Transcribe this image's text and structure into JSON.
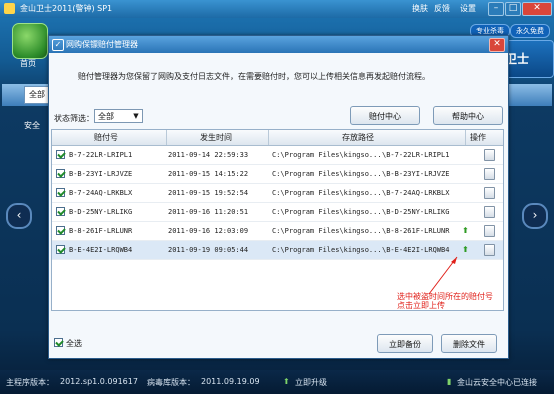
{
  "app": {
    "title": "金山卫士2011(警钟) SP1",
    "titlebar_links": {
      "skin": "换肤",
      "feedback": "反馈",
      "settings": "设置"
    },
    "badges": [
      "专业杀毒",
      "永久免费"
    ],
    "nav_first": "首页",
    "quick_tab": "全部",
    "side_label": "安全"
  },
  "dialog": {
    "title": "网购保镖赔付管理器",
    "description": "赔付管理器为您保留了网购及支付日志文件，在需要赔付时，您可以上传相关信息再发起赔付流程。",
    "filter_label": "状态筛选：",
    "filter_value": "全部",
    "buttons": {
      "payout_center": "赔付中心",
      "help_center": "帮助中心",
      "backup_now": "立即备份",
      "delete_files": "删除文件"
    },
    "select_all": "全选",
    "columns": {
      "id": "赔付号",
      "time": "发生时间",
      "path": "存放路径",
      "action": "操作"
    },
    "rows": [
      {
        "id": "B-7-22LR-LRIPL1",
        "time": "2011-09-14 22:59:33",
        "path": "C:\\Program Files\\kingso...",
        "file": "\\B-7-22LR-LRIPL1",
        "upload": false
      },
      {
        "id": "B-B-23YI-LRJVZE",
        "time": "2011-09-15 14:15:22",
        "path": "C:\\Program Files\\kingso...",
        "file": "\\B-B-23YI-LRJVZE",
        "upload": false
      },
      {
        "id": "B-7-24AQ-LRKBLX",
        "time": "2011-09-15 19:52:54",
        "path": "C:\\Program Files\\kingso...",
        "file": "\\B-7-24AQ-LRKBLX",
        "upload": false
      },
      {
        "id": "B-D-25NY-LRLIKG",
        "time": "2011-09-16 11:20:51",
        "path": "C:\\Program Files\\kingso...",
        "file": "\\B-D-25NY-LRLIKG",
        "upload": false
      },
      {
        "id": "B-8-261F-LRLUNR",
        "time": "2011-09-16 12:03:09",
        "path": "C:\\Program Files\\kingso...",
        "file": "\\B-8-261F-LRLUNR",
        "upload": true
      },
      {
        "id": "B-E-4E2I-LRQWB4",
        "time": "2011-09-19 09:05:44",
        "path": "C:\\Program Files\\kingso...",
        "file": "\\B-E-4E2I-LRQWB4",
        "upload": true
      }
    ],
    "note_line1": "选中被盗时间所在的赔付号",
    "note_line2": "点击立即上传"
  },
  "status": {
    "engine_label": "主程序版本：",
    "engine_ver": "2012.sp1.0.091617",
    "db_label": "病毒库版本：",
    "db_ver": "2011.09.19.09",
    "upgrade": "立即升级",
    "cloud": "金山云安全中心已连接"
  },
  "colors": {
    "accent": "#2a74b6",
    "note": "#e0201a",
    "upload": "#2d9a22"
  }
}
